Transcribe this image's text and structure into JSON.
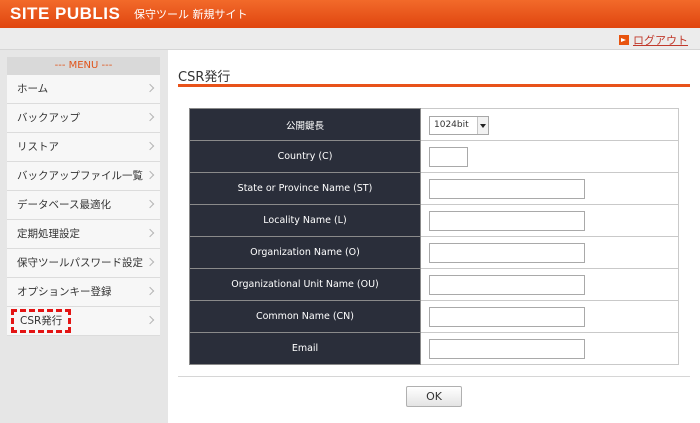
{
  "header": {
    "brand": "SITE PUBLIS",
    "subtitle": "保守ツール 新規サイト"
  },
  "subbar": {
    "logout_label": "ログアウト"
  },
  "sidebar": {
    "title": "--- MENU ---",
    "items": [
      {
        "label": "ホーム"
      },
      {
        "label": "バックアップ"
      },
      {
        "label": "リストア"
      },
      {
        "label": "バックアップファイル一覧"
      },
      {
        "label": "データベース最適化"
      },
      {
        "label": "定期処理設定"
      },
      {
        "label": "保守ツールパスワード設定"
      },
      {
        "label": "オプションキー登録"
      },
      {
        "label": "CSR発行"
      }
    ]
  },
  "main": {
    "title": "CSR発行",
    "form": {
      "key_length_label": "公開鍵長",
      "key_length_value": "1024bit",
      "rows": [
        {
          "label": "Country (C)",
          "value": ""
        },
        {
          "label": "State or Province Name (ST)",
          "value": ""
        },
        {
          "label": "Locality Name (L)",
          "value": ""
        },
        {
          "label": "Organization Name (O)",
          "value": ""
        },
        {
          "label": "Organizational Unit Name (OU)",
          "value": ""
        },
        {
          "label": "Common Name (CN)",
          "value": ""
        },
        {
          "label": "Email",
          "value": ""
        }
      ]
    },
    "ok_label": "OK"
  },
  "colors": {
    "accent": "#e8521a",
    "label_bg": "#2a2e3a",
    "highlight": "#e31414"
  }
}
